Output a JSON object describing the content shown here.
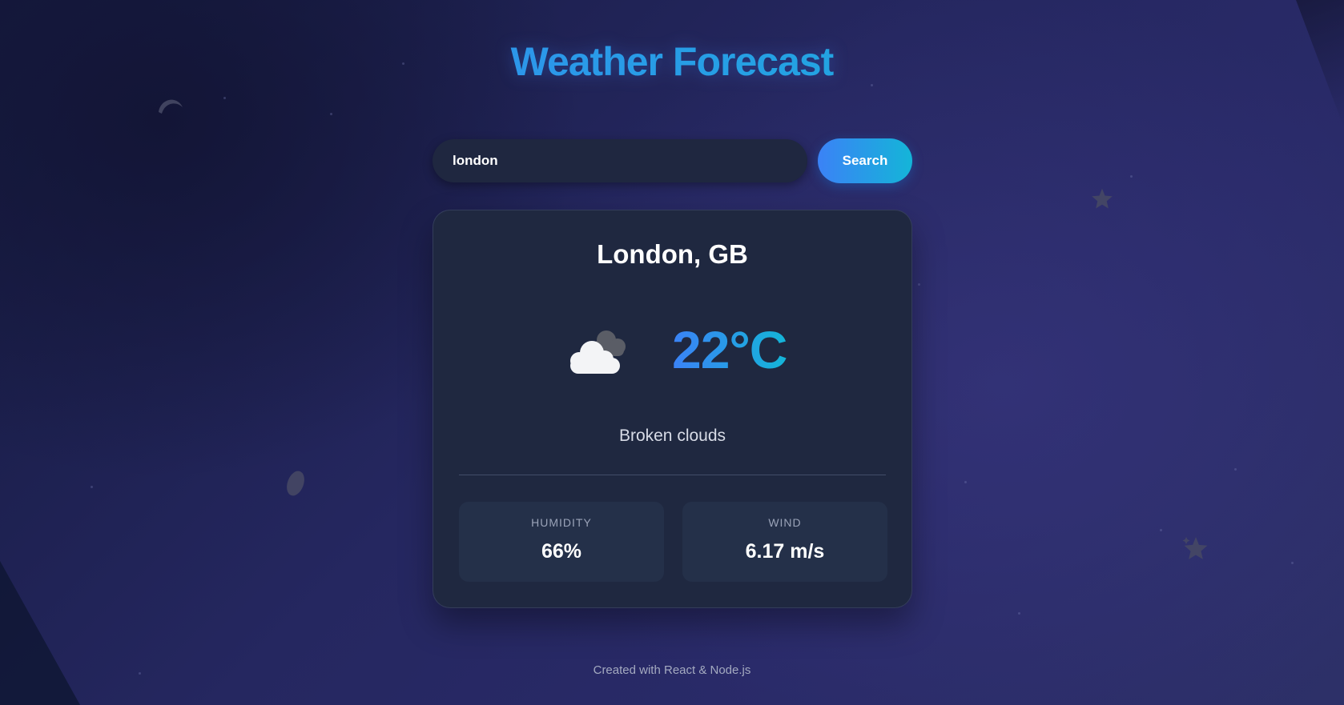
{
  "header": {
    "title": "Weather Forecast"
  },
  "search": {
    "value": "london",
    "button_label": "Search"
  },
  "weather": {
    "city": "London, GB",
    "icon": "broken-clouds-icon",
    "temperature": "22°C",
    "description": "Broken clouds",
    "stats": [
      {
        "label": "HUMIDITY",
        "value": "66%"
      },
      {
        "label": "WIND",
        "value": "6.17 m/s"
      }
    ]
  },
  "footer": {
    "text": "Created with React & Node.js"
  },
  "colors": {
    "accent_start": "#3b82f6",
    "accent_end": "#14b8d6",
    "card_bg": "#1f2840",
    "page_bg": "#252760"
  }
}
